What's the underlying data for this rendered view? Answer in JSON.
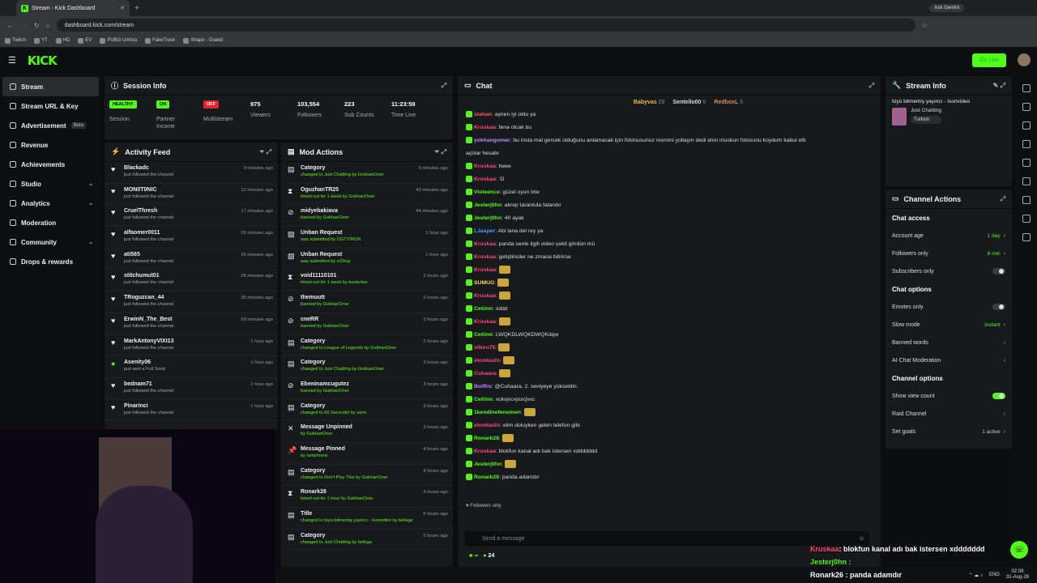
{
  "browser": {
    "tab_title": "Stream - Kick Dashboard",
    "url": "dashboard.kick.com/stream",
    "ask_gemini": "Ask Gemini",
    "bookmarks": [
      "Twitch",
      "YT",
      "HD",
      "EV",
      "PUBG Umbra",
      "FakeTruck",
      "Shape - Dialed"
    ]
  },
  "topnav": {
    "logo": "KICK",
    "go_live": "Go Live"
  },
  "sidebar": {
    "items": [
      {
        "label": "Stream"
      },
      {
        "label": "Stream URL & Key"
      },
      {
        "label": "Advertisement",
        "badge": "Beta"
      },
      {
        "label": "Revenue"
      },
      {
        "label": "Achievements"
      },
      {
        "label": "Studio"
      },
      {
        "label": "Analytics"
      },
      {
        "label": "Moderation"
      },
      {
        "label": "Community"
      },
      {
        "label": "Drops & rewards"
      }
    ]
  },
  "session": {
    "title": "Session Info",
    "stats": [
      {
        "badge": "HEALTHY",
        "label": "Session"
      },
      {
        "badge": "ON",
        "label": "Partner Income"
      },
      {
        "badge": "OFF",
        "label": "Multistream"
      },
      {
        "value": "975",
        "label": "Viewers"
      },
      {
        "value": "103,554",
        "label": "Followers"
      },
      {
        "value": "223",
        "label": "Sub Counts"
      },
      {
        "value": "11:23:59",
        "label": "Time Live"
      }
    ]
  },
  "activity": {
    "title": "Activity Feed",
    "rows": [
      {
        "name": "Blackadc",
        "sub": "just followed the channel",
        "time": "9 minutes ago"
      },
      {
        "name": "MON0T0NIC",
        "sub": "just followed the channel",
        "time": "12 minutes ago"
      },
      {
        "name": "CruelThresh",
        "sub": "just followed the channel",
        "time": "17 minutes ago"
      },
      {
        "name": "alfaomer0011",
        "sub": "just followed the channel",
        "time": "25 minutes ago"
      },
      {
        "name": "ati565",
        "sub": "just followed the channel",
        "time": "25 minutes ago"
      },
      {
        "name": "stitchumut01",
        "sub": "just followed the channel",
        "time": "26 minutes ago"
      },
      {
        "name": "TRoguzcan_44",
        "sub": "just followed the channel",
        "time": "35 minutes ago"
      },
      {
        "name": "ErwinN_The_Best",
        "sub": "just followed the channel",
        "time": "59 minutes ago"
      },
      {
        "name": "MarkAntonyVIXI13",
        "sub": "just followed the channel",
        "time": "1 hour ago"
      },
      {
        "name": "Asenity06",
        "sub": "just sent a Full Send",
        "time": "1 hour ago"
      },
      {
        "name": "bednam71",
        "sub": "just followed the channel",
        "time": "1 hour ago"
      },
      {
        "name": "Pinarinci",
        "sub": "just followed the channel",
        "time": "1 hour ago"
      }
    ]
  },
  "mod": {
    "title": "Mod Actions",
    "rows": [
      {
        "name": "Category",
        "sub": "changed to Just Chatting by GokhanOner",
        "time": "6 minutes ago"
      },
      {
        "name": "OguzhanTR25",
        "sub": "timed out for 1 week by GokhanOner",
        "time": "43 minutes ago"
      },
      {
        "name": "midyebakiava",
        "sub": "banned by GokhanOner",
        "time": "44 minutes ago"
      },
      {
        "name": "Unban Request",
        "sub": "was submitted by CGTYIRON",
        "time": "1 hour ago"
      },
      {
        "name": "Unban Request",
        "sub": "was submitted by e10ray",
        "time": "1 hour ago"
      },
      {
        "name": "void11110101",
        "sub": "timed out for 1 week by benturker",
        "time": "2 hours ago"
      },
      {
        "name": "themuutt",
        "sub": "banned by GokhanOner",
        "time": "2 hours ago"
      },
      {
        "name": "cneRR",
        "sub": "banned by GokhanOner",
        "time": "2 hours ago"
      },
      {
        "name": "Category",
        "sub": "changed to League of Legends by GokhanOner",
        "time": "2 hours ago"
      },
      {
        "name": "Category",
        "sub": "changed to Just Chatting by GokhanOner",
        "time": "3 hours ago"
      },
      {
        "name": "Ebeninamcugutez",
        "sub": "banned by GokhanOner",
        "time": "3 hours ago"
      },
      {
        "name": "Category",
        "sub": "changed to 60 Seconds! by sarw",
        "time": "3 hours ago"
      },
      {
        "name": "Message Unpinned",
        "sub": "by GokhanOner",
        "time": "3 hours ago"
      },
      {
        "name": "Message Pinned",
        "sub": "by lamphoros",
        "time": "4 hours ago"
      },
      {
        "name": "Category",
        "sub": "changed to Don't Play This by GokhanOner",
        "time": "4 hours ago"
      },
      {
        "name": "Ronark26",
        "sub": "timed out for 1 hour by GokhanOner",
        "time": "4 hours ago"
      },
      {
        "name": "Title",
        "sub": "changed to tüyü bitmemiş yayıncı - Isonvideo by befega",
        "time": "5 hours ago"
      },
      {
        "name": "Category",
        "sub": "changed to Just Chatting by befega",
        "time": "5 hours ago"
      }
    ]
  },
  "chat": {
    "title": "Chat",
    "top": [
      {
        "name": "Babyvas",
        "count": "29"
      },
      {
        "name": "Sentello00",
        "count": "6"
      },
      {
        "name": "RedboxL",
        "count": "5"
      }
    ],
    "lines": [
      {
        "user": "stahan",
        "color": "#ff5a5a",
        "msg": "aynen iyi oldu ya"
      },
      {
        "user": "Kruskaa",
        "color": "#ff4a7a",
        "msg": "fena olcak bu"
      },
      {
        "user": "yokhangomer",
        "color": "#b98cff",
        "msg": "bu insta mal gercek olduğunu anlamacak için fotonusunuz resmini yollayın dedi elon muskun fotosunu koydum kabul etti"
      },
      {
        "user": "",
        "color": "#ddd",
        "msg": "açtılar hesabı"
      },
      {
        "user": "Kruskaa",
        "color": "#ff4a7a",
        "msg": "heee"
      },
      {
        "user": "Kruskaa",
        "color": "#ff4a7a",
        "msg": ":D"
      },
      {
        "user": "Violeence",
        "color": "#53fc18",
        "msg": "güzel oyun btw"
      },
      {
        "user": "Jesterj0hn",
        "color": "#53fc18",
        "msg": "akrep tarantula falandır"
      },
      {
        "user": "Jesterj0hn",
        "color": "#53fc18",
        "msg": "40 ayak"
      },
      {
        "user": "LJasper",
        "color": "#4aa3ff",
        "msg": "Abi lana del rey ya"
      },
      {
        "user": "Kruskaa",
        "color": "#ff4a7a",
        "msg": "panda senle ilgili video çekti gördün mü"
      },
      {
        "user": "Kruskaa",
        "color": "#ff4a7a",
        "msg": "geliştiriciler ne zmana bitirirse"
      },
      {
        "user": "Kruskaa",
        "color": "#ff4a7a",
        "msg": ""
      },
      {
        "user": "SUMUG",
        "color": "#ffd84a",
        "msg": ""
      },
      {
        "user": "Kruskaa",
        "color": "#ff4a7a",
        "msg": ""
      },
      {
        "user": "Cetiinn",
        "color": "#53fc18",
        "msg": "xddd"
      },
      {
        "user": "Kruskaa",
        "color": "#ff4a7a",
        "msg": ""
      },
      {
        "user": "Cetiinn",
        "color": "#53fc18",
        "msg": "LWQKDLWQKDWQKdqw"
      },
      {
        "user": "nibiru75",
        "color": "#ff4a7a",
        "msg": ""
      },
      {
        "user": "elomtasfo",
        "color": "#ff4a7a",
        "msg": ""
      },
      {
        "user": "Cuhaara",
        "color": "#ff4a7a",
        "msg": ""
      },
      {
        "user": "BotRix",
        "color": "#b98cff",
        "msg": "@Cuhaara, 2. seviyeye yükseldin."
      },
      {
        "user": "Cetiinn",
        "color": "#53fc18",
        "msg": "xckvjxcvjxxcjvxc"
      },
      {
        "user": "1kendinefenomen",
        "color": "#53fc18",
        "msg": ""
      },
      {
        "user": "elomtasfo",
        "color": "#ff4a7a",
        "msg": "elim doluyken gelen telefon gibi"
      },
      {
        "user": "Ronark26",
        "color": "#53fc18",
        "msg": ""
      },
      {
        "user": "Kruskaa",
        "color": "#ff4a7a",
        "msg": "blokfun kanal adı bak istersen xddddddd"
      },
      {
        "user": "Jesterj0hn",
        "color": "#53fc18",
        "msg": ""
      },
      {
        "user": "Ronark26",
        "color": "#53fc18",
        "msg": "panda adamdır"
      }
    ],
    "followers_only": "Followers only",
    "placeholder": "Send a message",
    "viewer_count": "24"
  },
  "stream_info": {
    "title": "Stream Info",
    "stream_title": "tüyü bitmemiş yayıncı - Isonvideo",
    "category": "Just Chatting",
    "tag": "Turkish"
  },
  "channel_actions": {
    "title": "Channel Actions",
    "sections": [
      {
        "header": "Chat access"
      },
      {
        "label": "Account age",
        "value": "1 day"
      },
      {
        "label": "Followers only",
        "value": "6 min"
      },
      {
        "label": "Subscribers only",
        "toggle": "off"
      },
      {
        "header": "Chat options"
      },
      {
        "label": "Emotes only",
        "toggle": "off"
      },
      {
        "label": "Slow mode",
        "value": "Instant"
      },
      {
        "label": "Banned words"
      },
      {
        "label": "AI Chat Moderation"
      },
      {
        "header": "Channel options"
      },
      {
        "label": "Show view count",
        "toggle": "on"
      },
      {
        "label": "Raid Channel"
      },
      {
        "label": "Set goals",
        "value": "1 active"
      }
    ]
  },
  "overlay": {
    "line1_user": "Kruskaa",
    "line1_msg": ": blokfun kanal adı bak istersen xddddddd",
    "line2_user": "Jesterj0hn",
    "line3": "Ronark26 : panda adamdır"
  },
  "taskbar": {
    "lang": "ENG",
    "time": "02:08",
    "date": "31-Aug-26"
  }
}
